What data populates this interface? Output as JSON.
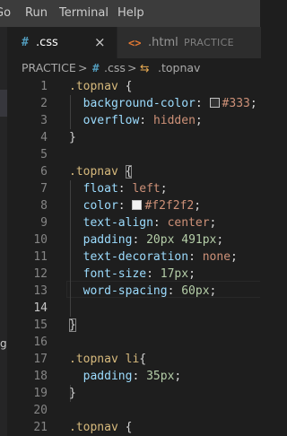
{
  "menubar": {
    "items": [
      "Go",
      "Run",
      "Terminal",
      "Help"
    ]
  },
  "sidebar": {
    "visible_fragment": "g"
  },
  "tabs": [
    {
      "icon": "#",
      "label": ".css",
      "close": "×",
      "active": true
    },
    {
      "icon": "<>",
      "label": ".html",
      "sublabel": "PRACTICE",
      "active": false
    }
  ],
  "breadcrumb": {
    "folder": "PRACTICE",
    "sep": ">",
    "file_icon": "#",
    "file": ".css",
    "symbol_icon": "⇆",
    "symbol": ".topnav"
  },
  "editor": {
    "colors": {
      "selector": "#d7ba7d",
      "property": "#9cdcfe",
      "value": "#ce9178",
      "number": "#b5cea8"
    },
    "lines": [
      {
        "n": "1",
        "tokens": [
          [
            "sel",
            ".topnav"
          ],
          [
            "brace",
            " {"
          ]
        ]
      },
      {
        "n": "2",
        "tokens": [
          [
            "prop",
            "  background-color"
          ],
          [
            "punc",
            ": "
          ],
          [
            "swatch",
            "#333333"
          ],
          [
            "val",
            "#333"
          ],
          [
            "punc",
            ";"
          ]
        ]
      },
      {
        "n": "3",
        "tokens": [
          [
            "prop",
            "  overflow"
          ],
          [
            "punc",
            ": "
          ],
          [
            "val",
            "hidden"
          ],
          [
            "punc",
            ";"
          ]
        ]
      },
      {
        "n": "4",
        "tokens": [
          [
            "brace",
            "}"
          ]
        ]
      },
      {
        "n": "5",
        "tokens": []
      },
      {
        "n": "6",
        "tokens": [
          [
            "sel",
            ".topnav"
          ],
          [
            "brace",
            " "
          ],
          [
            "match",
            "{"
          ]
        ]
      },
      {
        "n": "7",
        "tokens": [
          [
            "prop",
            "  float"
          ],
          [
            "punc",
            ": "
          ],
          [
            "val",
            "left"
          ],
          [
            "punc",
            ";"
          ]
        ]
      },
      {
        "n": "8",
        "tokens": [
          [
            "prop",
            "  color"
          ],
          [
            "punc",
            ": "
          ],
          [
            "swatch",
            "#f2f2f2"
          ],
          [
            "val",
            "#f2f2f2"
          ],
          [
            "punc",
            ";"
          ]
        ]
      },
      {
        "n": "9",
        "tokens": [
          [
            "prop",
            "  text-align"
          ],
          [
            "punc",
            ": "
          ],
          [
            "val",
            "center"
          ],
          [
            "punc",
            ";"
          ]
        ]
      },
      {
        "n": "10",
        "tokens": [
          [
            "prop",
            "  padding"
          ],
          [
            "punc",
            ": "
          ],
          [
            "num",
            "20px 491px"
          ],
          [
            "punc",
            ";"
          ]
        ]
      },
      {
        "n": "11",
        "tokens": [
          [
            "prop",
            "  text-decoration"
          ],
          [
            "punc",
            ": "
          ],
          [
            "val",
            "none"
          ],
          [
            "punc",
            ";"
          ]
        ]
      },
      {
        "n": "12",
        "tokens": [
          [
            "prop",
            "  font-size"
          ],
          [
            "punc",
            ": "
          ],
          [
            "num",
            "17px"
          ],
          [
            "punc",
            ";"
          ]
        ]
      },
      {
        "n": "13",
        "tokens": [
          [
            "prop",
            "  word-spacing"
          ],
          [
            "punc",
            ": "
          ],
          [
            "num",
            "60px"
          ],
          [
            "punc",
            ";"
          ]
        ]
      },
      {
        "n": "14",
        "tokens": []
      },
      {
        "n": "15",
        "tokens": [
          [
            "match",
            "}"
          ]
        ]
      },
      {
        "n": "16",
        "tokens": []
      },
      {
        "n": "17",
        "tokens": [
          [
            "sel",
            ".topnav li"
          ],
          [
            "brace",
            "{"
          ]
        ]
      },
      {
        "n": "18",
        "tokens": [
          [
            "prop",
            "  padding"
          ],
          [
            "punc",
            ": "
          ],
          [
            "num",
            "35px"
          ],
          [
            "punc",
            ";"
          ]
        ]
      },
      {
        "n": "19",
        "tokens": [
          [
            "brace",
            "}"
          ]
        ]
      },
      {
        "n": "20",
        "tokens": []
      },
      {
        "n": "21",
        "tokens": [
          [
            "sel",
            ".topnav"
          ],
          [
            "brace",
            " {"
          ]
        ]
      }
    ],
    "active_line": "14"
  }
}
